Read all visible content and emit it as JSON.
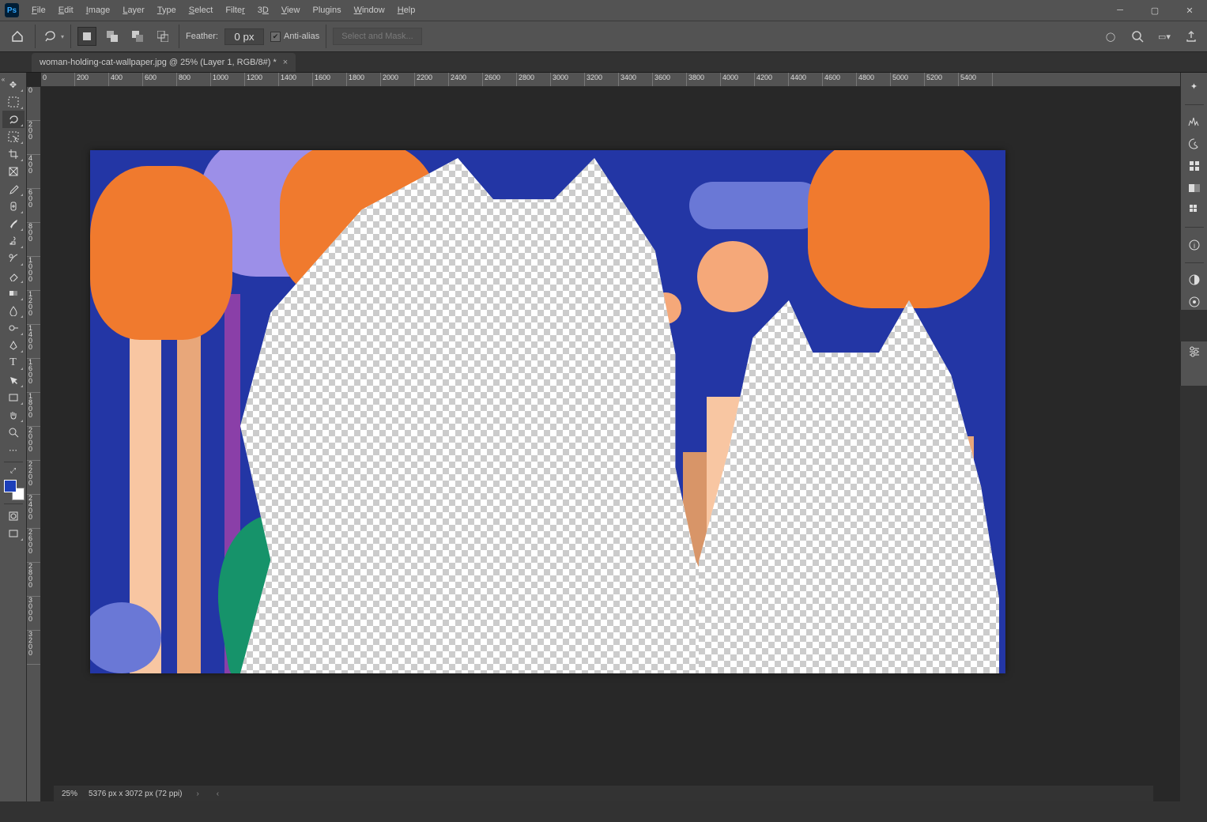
{
  "app": {
    "logo": "Ps"
  },
  "menu": [
    "File",
    "Edit",
    "Image",
    "Layer",
    "Type",
    "Select",
    "Filter",
    "3D",
    "View",
    "Plugins",
    "Window",
    "Help"
  ],
  "options": {
    "feather_label": "Feather:",
    "feather_value": "0 px",
    "antialias_label": "Anti-alias",
    "antialias_checked": true,
    "select_mask": "Select and Mask..."
  },
  "tab": {
    "title": "woman-holding-cat-wallpaper.jpg @ 25% (Layer 1, RGB/8#) *"
  },
  "rulersH": [
    "0",
    "200",
    "400",
    "600",
    "800",
    "1000",
    "1200",
    "1400",
    "1600",
    "1800",
    "2000",
    "2200",
    "2400",
    "2600",
    "2800",
    "3000",
    "3200",
    "3400",
    "3600",
    "3800",
    "4000",
    "4200",
    "4400",
    "4600",
    "4800",
    "5000",
    "5200",
    "5400"
  ],
  "rulersV": [
    "0",
    "200",
    "400",
    "600",
    "800",
    "1000",
    "1200",
    "1400",
    "1600",
    "1800",
    "2000",
    "2200",
    "2400",
    "2600",
    "2800",
    "3000",
    "3200"
  ],
  "status": {
    "zoom": "25%",
    "docinfo": "5376 px x 3072 px (72 ppi)"
  },
  "colors": {
    "foreground": "#1c3fba",
    "background": "#ffffff"
  },
  "tools_left": [
    "move",
    "marquee",
    "lasso",
    "object-select",
    "crop",
    "frame",
    "eyedropper",
    "heal",
    "brush",
    "stamp",
    "history-brush",
    "eraser",
    "gradient",
    "blur",
    "dodge",
    "pen",
    "type",
    "path-select",
    "rectangle",
    "hand",
    "zoom",
    "more"
  ],
  "tools_selected": "lasso",
  "panels_right1": [
    "bug",
    "histogram",
    "swatches",
    "grid",
    "picker",
    "tiles"
  ],
  "panels_right2": [
    "info"
  ],
  "panels_right3": [
    "adjust",
    "fill"
  ],
  "panels_right4": [
    "prop"
  ]
}
